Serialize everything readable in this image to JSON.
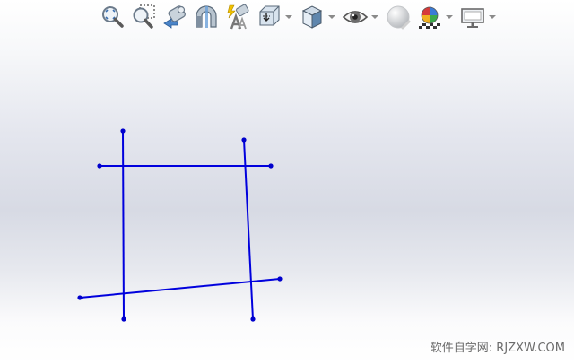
{
  "toolbar": {
    "items": [
      {
        "icon": "zoom-to-fit-icon",
        "has_dropdown": false
      },
      {
        "icon": "zoom-to-area-icon",
        "has_dropdown": false
      },
      {
        "icon": "previous-view-icon",
        "has_dropdown": false
      },
      {
        "icon": "section-view-icon",
        "has_dropdown": false
      },
      {
        "icon": "dynamic-annotation-views-icon",
        "has_dropdown": false
      },
      {
        "icon": "view-orientation-icon",
        "has_dropdown": true
      },
      {
        "icon": "display-style-icon",
        "has_dropdown": true
      },
      {
        "icon": "hide-show-items-icon",
        "has_dropdown": true
      },
      {
        "icon": "edit-appearance-icon",
        "has_dropdown": false
      },
      {
        "icon": "apply-scene-icon",
        "has_dropdown": true
      },
      {
        "icon": "view-settings-icon",
        "has_dropdown": true
      }
    ]
  },
  "sketch": {
    "line_color": "#0000dd",
    "point_color": "#0000cc"
  },
  "watermark": {
    "text": "软件自学网: RJZXW.COM"
  }
}
